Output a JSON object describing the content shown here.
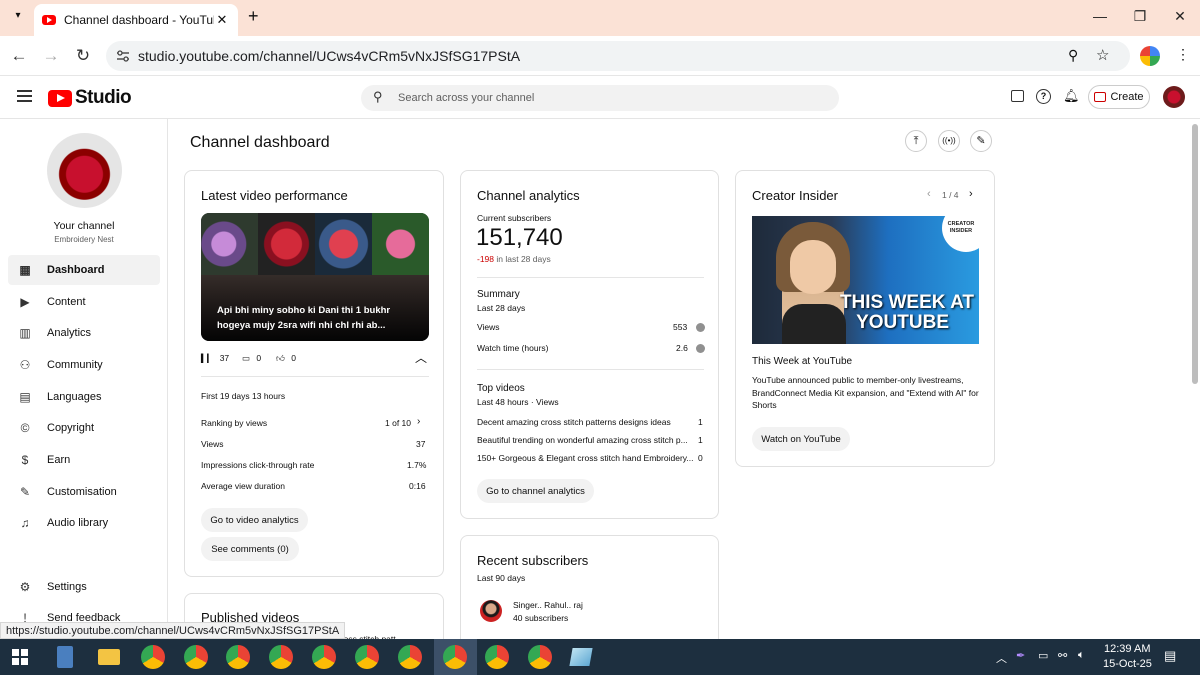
{
  "browser": {
    "tab_title": "Channel dashboard - YouTube",
    "new_tab": "+",
    "url": "studio.youtube.com/channel/UCws4vCRm5vNxJSfSG17PStA",
    "status_url": "https://studio.youtube.com/channel/UCws4vCRm5vNxJSfSG17PStA"
  },
  "studio": {
    "logo_text": "Studio",
    "search_placeholder": "Search across your channel",
    "create_label": "Create"
  },
  "sidebar": {
    "your_channel": "Your channel",
    "channel_name": "Embroidery Nest",
    "items": [
      {
        "label": "Dashboard",
        "icon": "dashboard-icon"
      },
      {
        "label": "Content",
        "icon": "content-icon"
      },
      {
        "label": "Analytics",
        "icon": "analytics-icon"
      },
      {
        "label": "Community",
        "icon": "community-icon"
      },
      {
        "label": "Languages",
        "icon": "languages-icon"
      },
      {
        "label": "Copyright",
        "icon": "copyright-icon"
      },
      {
        "label": "Earn",
        "icon": "earn-icon"
      },
      {
        "label": "Customisation",
        "icon": "customisation-icon"
      },
      {
        "label": "Audio library",
        "icon": "audio-library-icon"
      }
    ],
    "settings": "Settings",
    "send_feedback": "Send feedback"
  },
  "page_title": "Channel dashboard",
  "latest_video": {
    "title": "Latest video performance",
    "video_title": "Api bhi miny sobho ki Dani thi 1 bukhr hogeya mujy 2sra wifi nhi chl rhi ab...",
    "views_stat": "37",
    "comments_stat": "0",
    "likes_stat": "0",
    "period": "First 19 days 13 hours",
    "rows": [
      {
        "label": "Ranking by views",
        "value": "1 of 10"
      },
      {
        "label": "Views",
        "value": "37"
      },
      {
        "label": "Impressions click-through rate",
        "value": "1.7%"
      },
      {
        "label": "Average view duration",
        "value": "0:16"
      }
    ],
    "analytics_button": "Go to video analytics",
    "comments_button": "See comments (0)"
  },
  "published_videos": {
    "title": "Published videos",
    "preview": "...beautiful cross stitch patt..."
  },
  "channel_analytics": {
    "title": "Channel analytics",
    "current_subscribers_label": "Current subscribers",
    "subscribers": "151,740",
    "change": "-198",
    "change_suffix": "in last 28 days",
    "summary_label": "Summary",
    "summary_period": "Last 28 days",
    "summary_rows": [
      {
        "label": "Views",
        "value": "553"
      },
      {
        "label": "Watch time (hours)",
        "value": "2.6"
      }
    ],
    "top_videos_label": "Top videos",
    "top_videos_period": "Last 48 hours · Views",
    "top_videos": [
      {
        "title": "Decent amazing cross stitch patterns designs ideas",
        "views": "1"
      },
      {
        "title": "Beautiful trending on wonderful amazing cross stitch p...",
        "views": "1"
      },
      {
        "title": "150+ Gorgeous & Elegant cross stitch hand Embroidery...",
        "views": "0"
      }
    ],
    "button": "Go to channel analytics"
  },
  "recent_subscribers": {
    "title": "Recent subscribers",
    "period": "Last 90 days",
    "items": [
      {
        "name": "Singer.. Rahul.. raj",
        "subs": "40 subscribers"
      }
    ]
  },
  "creator_insider": {
    "title": "Creator Insider",
    "pager": "1 / 4",
    "thumb_badge": "CREATOR INSIDER",
    "thumb_text_line1": "THIS WEEK AT",
    "thumb_text_line2": "YOUTUBE",
    "headline": "This Week at YouTube",
    "description": "YouTube announced public to member-only livestreams, BrandConnect Media Kit expansion, and \"Extend with AI\" for Shorts",
    "button": "Watch on YouTube"
  },
  "taskbar": {
    "time": "12:39 AM",
    "date": "15-Oct-25"
  },
  "colors": {
    "brand_red": "#ff0000",
    "negative": "#cc0000",
    "tab_strip": "#fbe2d6",
    "taskbar": "#1d2f3f"
  }
}
